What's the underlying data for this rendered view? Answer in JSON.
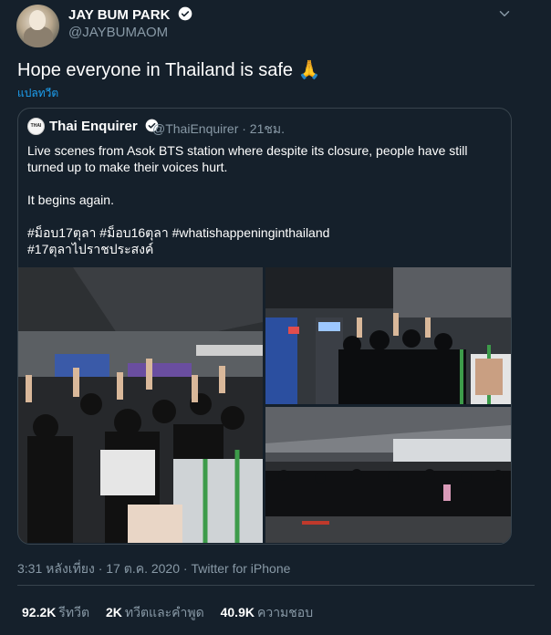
{
  "author": {
    "name": "JAY BUM PARK",
    "handle": "@JAYBUMAOM"
  },
  "tweet": {
    "text": "Hope everyone in Thailand is safe 🙏",
    "translate_label": "แปลทวีต"
  },
  "quote": {
    "avatar_text": "THAI",
    "name": "Thai Enquirer",
    "handle_time": "@ThaiEnquirer · 21ชม.",
    "lines": [
      "Live scenes from Asok BTS station where despite its closure, people have still",
      "turned up to make their voices hurt.",
      "It begins again.",
      "#ม็อบ17ตุลา #ม็อบ16ตุลา #whatishappeninginthailand",
      "#17ตุลาไปราชประสงค์"
    ]
  },
  "meta": {
    "timestamp": "3:31 หลังเที่ยง · 17 ต.ค. 2020 · Twitter for iPhone"
  },
  "stats": {
    "retweets_value": "92.2K",
    "retweets_label": "รีทวีต",
    "quotes_value": "2K",
    "quotes_label": "ทวีตและคำพูด",
    "likes_value": "40.9K",
    "likes_label": "ความชอบ"
  },
  "colors": {
    "background": "#15202b",
    "accent": "#1da1f2",
    "muted": "#8899a6",
    "border": "#38444d"
  },
  "icons": [
    "verified-badge-icon",
    "chevron-down-icon",
    "praying-hands-emoji"
  ]
}
